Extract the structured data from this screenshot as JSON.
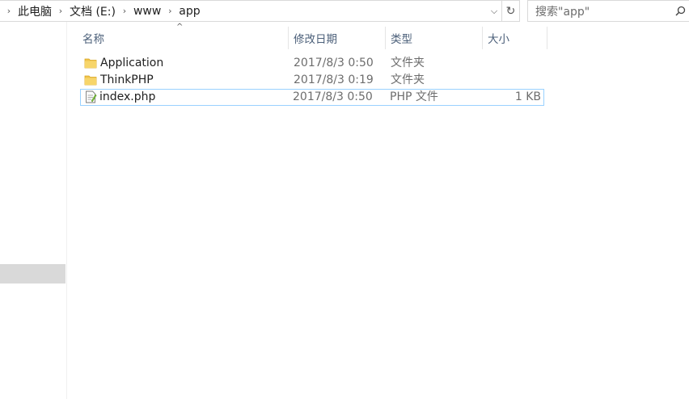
{
  "address_bar": {
    "crumbs": [
      "此电脑",
      "文档 (E:)",
      "www",
      "app"
    ]
  },
  "search": {
    "placeholder": "搜索\"app\""
  },
  "columns": {
    "name": "名称",
    "modified": "修改日期",
    "type": "类型",
    "size": "大小"
  },
  "files": [
    {
      "name": "Application",
      "modified": "2017/8/3 0:50",
      "type": "文件夹",
      "size": "",
      "icon": "folder-icon"
    },
    {
      "name": "ThinkPHP",
      "modified": "2017/8/3 0:19",
      "type": "文件夹",
      "size": "",
      "icon": "folder-icon"
    },
    {
      "name": "index.php",
      "modified": "2017/8/3 0:50",
      "type": "PHP 文件",
      "size": "1 KB",
      "icon": "php-file-icon"
    }
  ],
  "colors": {
    "folder": "#f0c44c",
    "focus_border": "#99d1ff",
    "header_text": "#4c607a"
  }
}
